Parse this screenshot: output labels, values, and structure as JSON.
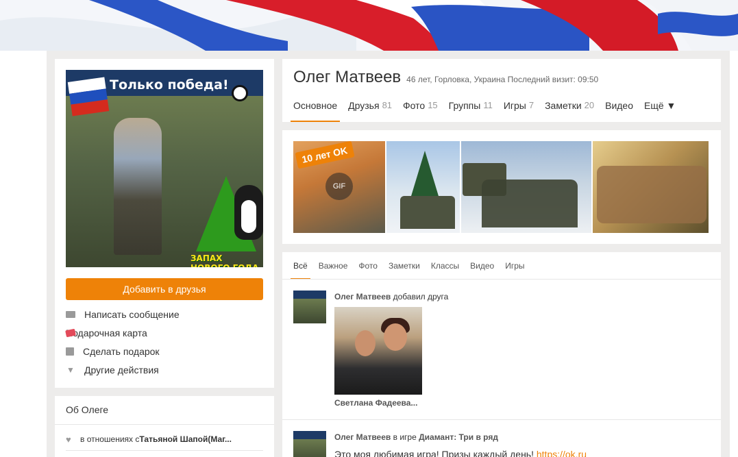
{
  "profile": {
    "name": "Олег Матвеев",
    "meta": "46 лет, Горловка, Украина  Последний визит: 09:50"
  },
  "avatar": {
    "promo_text": "Только победа!",
    "tree_caption": "ЗАПАХ НОВОГО ГОДА"
  },
  "actions": {
    "add_friend": "Добавить в друзья",
    "items": [
      {
        "label": "Написать сообщение",
        "icon": "mail-icon"
      },
      {
        "label": "Подарочная карта",
        "icon": "gift-card-icon"
      },
      {
        "label": "Сделать подарок",
        "icon": "gift-icon"
      },
      {
        "label": "Другие действия",
        "icon": "chevron-down-icon"
      }
    ]
  },
  "about": {
    "title": "Об Олеге",
    "relationship_prefix": "в отношениях с ",
    "relationship_name": "Татьяной Шапой(Маг..."
  },
  "tabs": [
    {
      "label": "Основное",
      "count": ""
    },
    {
      "label": "Друзья",
      "count": "81"
    },
    {
      "label": "Фото",
      "count": "15"
    },
    {
      "label": "Группы",
      "count": "11"
    },
    {
      "label": "Игры",
      "count": "7"
    },
    {
      "label": "Заметки",
      "count": "20"
    },
    {
      "label": "Видео",
      "count": ""
    },
    {
      "label": "Ещё ▼",
      "count": ""
    }
  ],
  "photos": {
    "first_tag": "10 лет OK",
    "gif_label": "GIF"
  },
  "feed_tabs": [
    "Всё",
    "Важное",
    "Фото",
    "Заметки",
    "Классы",
    "Видео",
    "Игры"
  ],
  "feed": {
    "item1": {
      "author": "Олег Матвеев",
      "action": " добавил друга",
      "friend_name": "Светлана Фадеева..."
    },
    "item2": {
      "author": "Олег Матвеев",
      "action": " в игре ",
      "game": "Диамант: Три в ряд",
      "text": "Это моя любимая игра! Призы каждый день! ",
      "link": "https://ok.ru"
    }
  },
  "colors": {
    "accent": "#ee8208",
    "page_bg": "#edeceb"
  }
}
